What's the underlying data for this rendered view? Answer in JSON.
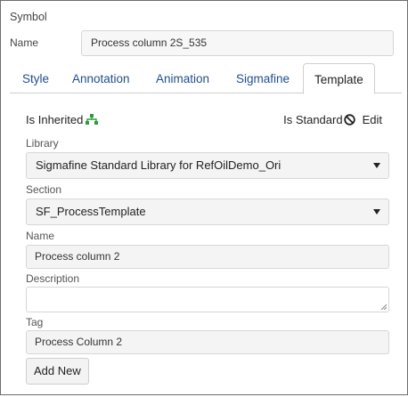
{
  "symbol": {
    "section_title": "Symbol",
    "name_label": "Name",
    "name_value": "Process column 2S_535"
  },
  "tabs": [
    {
      "label": "Style",
      "active": false
    },
    {
      "label": "Annotation",
      "active": false
    },
    {
      "label": "Animation",
      "active": false
    },
    {
      "label": "Sigmafine",
      "active": false
    },
    {
      "label": "Template",
      "active": true
    }
  ],
  "template": {
    "is_inherited_label": "Is Inherited",
    "inherited_icon": "hierarchy-icon",
    "is_standard_label": "Is Standard",
    "standard_icon": "ban-icon",
    "edit_label": "Edit",
    "library_label": "Library",
    "library_value": "Sigmafine Standard Library for RefOilDemo_Ori",
    "section_label": "Section",
    "section_value": "SF_ProcessTemplate",
    "name_label": "Name",
    "name_value": "Process column 2",
    "description_label": "Description",
    "description_value": "",
    "tag_label": "Tag",
    "tag_value": "Process Column 2",
    "add_new_label": "Add New"
  },
  "colors": {
    "tab_link": "#1f4e8c",
    "inherited_icon": "#2e9a3c",
    "frame_border": "#6d6d6d"
  }
}
